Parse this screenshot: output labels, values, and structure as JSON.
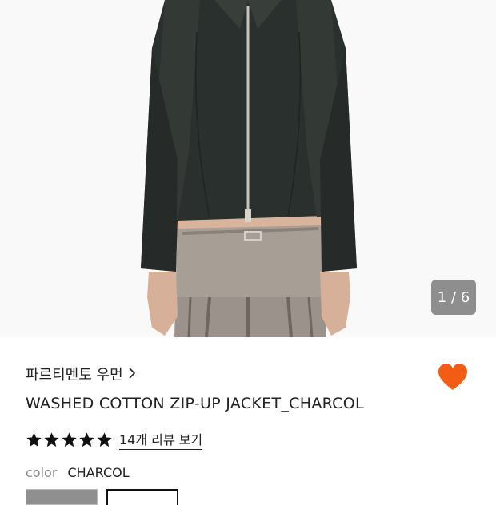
{
  "gallery": {
    "counter": "1 / 6"
  },
  "product": {
    "brand": "파르티멘토 우먼",
    "name": "WASHED COTTON ZIP-UP JACKET_CHARCOL",
    "rating_value": 5,
    "reviews_link": "14개 리뷰 보기",
    "color_label": "color",
    "color_value": "CHARCOL",
    "liked": true
  },
  "colors": {
    "heart": "#f25c14",
    "star": "#111111"
  }
}
